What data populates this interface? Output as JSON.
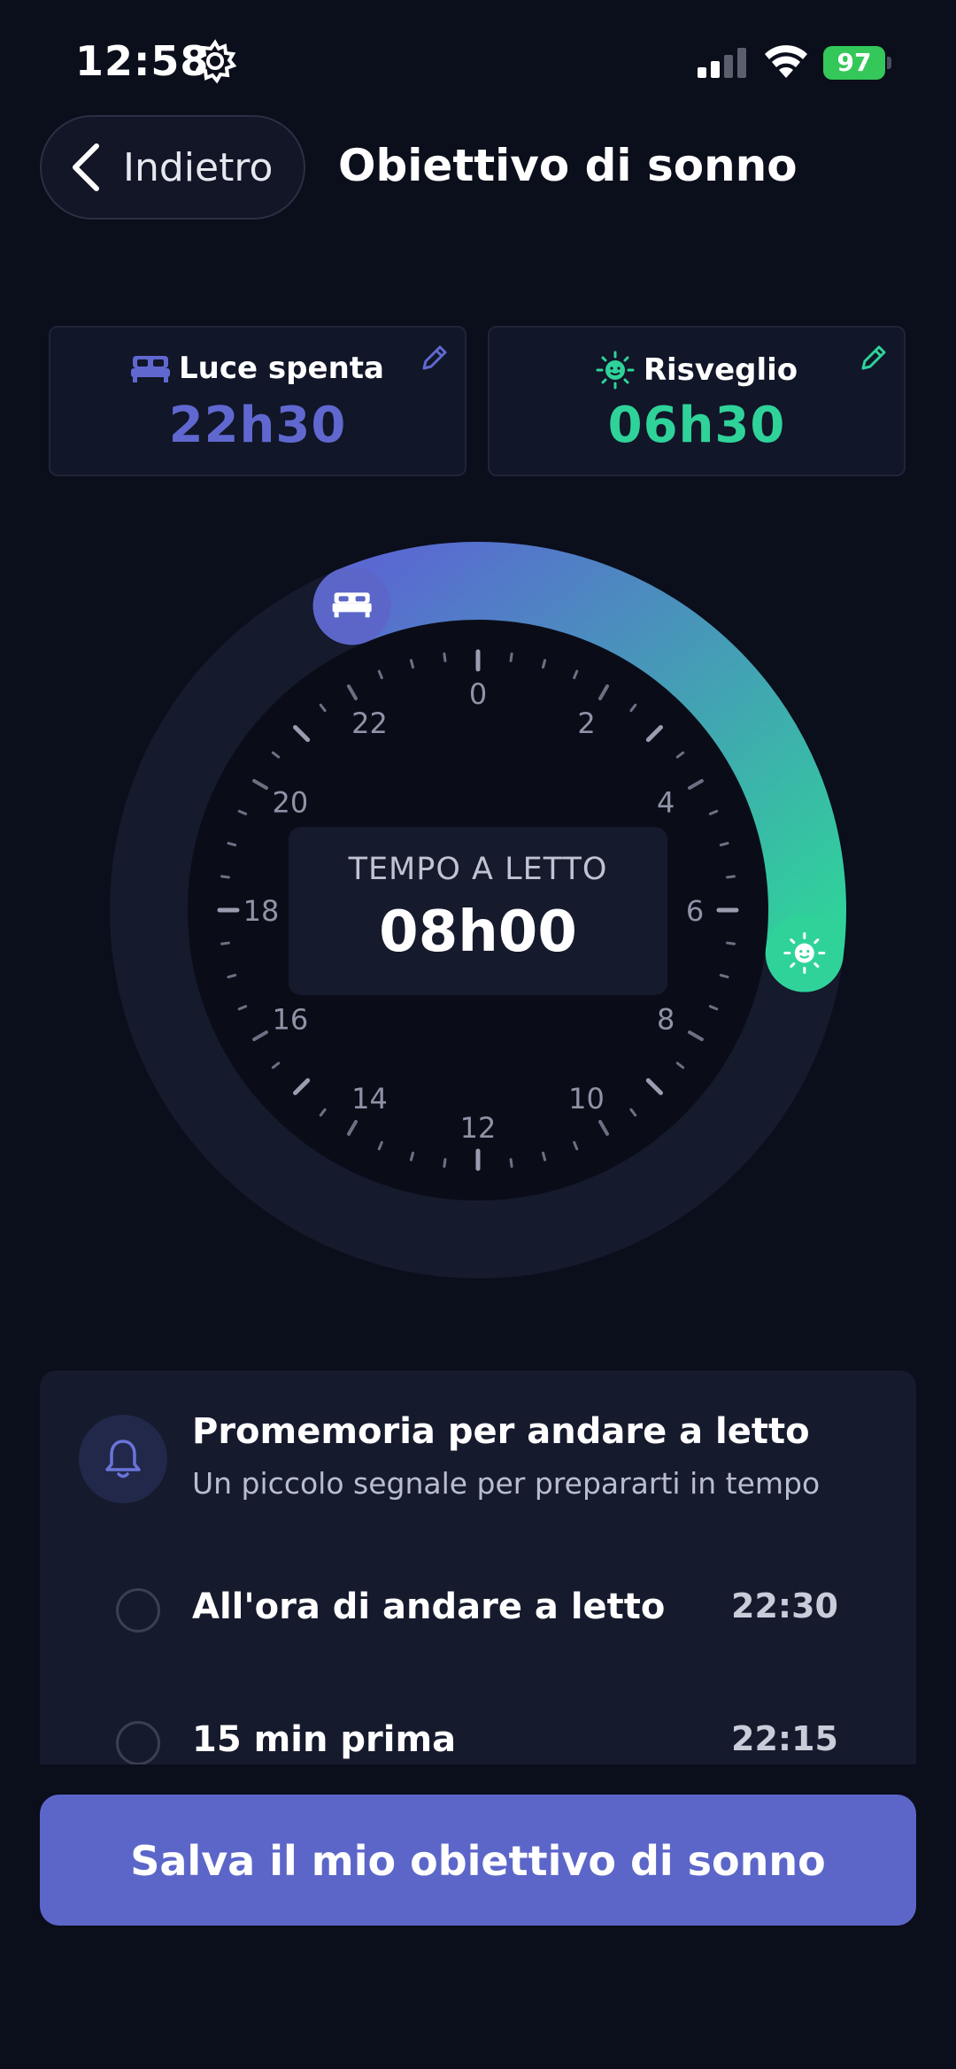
{
  "status_bar": {
    "time": "12:58",
    "battery": "97"
  },
  "header": {
    "back_label": "Indietro",
    "title": "Obiettivo di sonno"
  },
  "cards": {
    "bedtime": {
      "label": "Luce spenta",
      "value": "22h30"
    },
    "wake": {
      "label": "Risveglio",
      "value": "06h30"
    }
  },
  "clock": {
    "hour_labels": [
      "0",
      "2",
      "4",
      "6",
      "8",
      "10",
      "12",
      "14",
      "16",
      "18",
      "20",
      "22"
    ],
    "center_caption": "TEMPO A LETTO",
    "center_value": "08h00",
    "start_hour": 22.5,
    "end_hour": 6.5
  },
  "reminder": {
    "title": "Promemoria per andare a letto",
    "subtitle": "Un piccolo segnale per prepararti in tempo",
    "options": [
      {
        "label": "All'ora di andare a letto",
        "time": "22:30"
      },
      {
        "label": "15 min prima",
        "time": "22:15"
      }
    ]
  },
  "save_label": "Salva il mio obiettivo di sonno",
  "colors": {
    "background": "#0b0e1b",
    "accent": "#5c66c9",
    "bedtime": "#6068d0",
    "wake": "#2fd39a"
  },
  "icons": {
    "gear": "gear-icon",
    "bed": "bed-icon",
    "sun": "sun-face-icon",
    "pencil": "pencil-icon",
    "bell": "bell-icon",
    "back": "chevron-left-icon"
  }
}
